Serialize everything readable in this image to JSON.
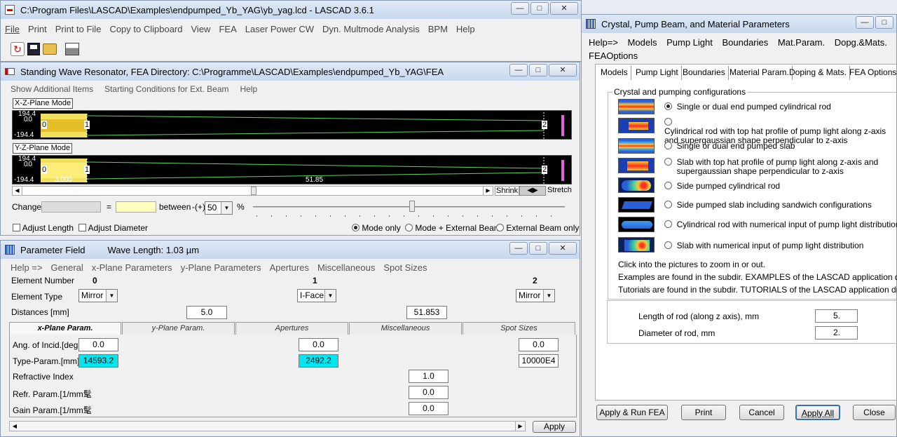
{
  "main_window": {
    "title": "C:\\Program Files\\LASCAD\\Examples\\endpumped_Yb_YAG\\yb_yag.lcd - LASCAD 3.6.1",
    "menu": [
      "File",
      "Print",
      "Print to File",
      "Copy to Clipboard",
      "View",
      "FEA",
      "Laser Power CW",
      "Dyn. Multmode Analysis",
      "BPM",
      "Help"
    ],
    "toolbar_icons": [
      "refresh-icon",
      "save-icon",
      "open-folder-icon",
      "printer-icon"
    ]
  },
  "resonator": {
    "title": "Standing Wave Resonator, FEA Directory: C:\\Programme\\LASCAD\\Examples\\endpumped_Yb_YAG\\FEA",
    "menu": [
      "Show Additional Items",
      "Starting Conditions for Ext. Beam",
      "Help"
    ],
    "xz_label": "X-Z-Plane Mode",
    "yz_label": "Y-Z-Plane Mode",
    "plot_top": "194.4",
    "plot_bottom": "-194.4",
    "plot_mid": "0.0",
    "element_labels": [
      "0",
      "1",
      "2"
    ],
    "yz_left_value": "3.000",
    "yz_mid_value": "51.85",
    "shrink_label": "Shrink",
    "stretch_label": "Stretch",
    "change_label": "Change",
    "equals": "=",
    "between_label": "between",
    "plusminus": "-(+)",
    "between_value": "50",
    "percent": "%",
    "adjust_length": "Adjust Length",
    "adjust_diameter": "Adjust Diameter",
    "mode_options": [
      "Mode only",
      "Mode + External Beam",
      "External Beam only"
    ],
    "mode_selected": "Mode only"
  },
  "param_field": {
    "title": "Parameter Field",
    "wavelength": "Wave Length: 1.03 µm",
    "menu": [
      "Help =>",
      "General",
      "x-Plane Parameters",
      "y-Plane Parameters",
      "Apertures",
      "Miscellaneous",
      "Spot Sizes"
    ],
    "element_number_label": "Element Number",
    "element_numbers": [
      "0",
      "1",
      "2"
    ],
    "element_type_label": "Element Type",
    "element_types": [
      "Mirror",
      "I-Face",
      "Mirror"
    ],
    "distances_label": "Distances [mm]",
    "distances": [
      "5.0",
      "51.853"
    ],
    "tabs": [
      "x-Plane Param.",
      "y-Plane Param.",
      "Apertures",
      "Miscellaneous",
      "Spot Sizes"
    ],
    "rows": {
      "angle_label": "Ang. of Incid.[deg.]",
      "angle_values": [
        "0.0",
        "0.0",
        "0.0"
      ],
      "type_label": "Type-Param.[mm]",
      "type_values": [
        "14593.2",
        "2492.2",
        "10000E4"
      ],
      "refr_index_label": "Refractive Index",
      "refr_index_value": "1.0",
      "refr_param_label": "Refr. Param.[1/mm髦",
      "refr_param_value": "0.0",
      "gain_param_label": "Gain Param.[1/mm髦",
      "gain_param_value": "0.0"
    },
    "apply_label": "Apply"
  },
  "crystal_dialog": {
    "title": "Crystal, Pump Beam, and Material Parameters",
    "menu": [
      "Help=>",
      "Models",
      "Pump Light",
      "Boundaries",
      "Mat.Param.",
      "Dopg.&Mats.",
      "FEAOptions"
    ],
    "tabs": [
      "Models",
      "Pump Light",
      "Boundaries",
      "Material Param.",
      "Doping & Mats.",
      "FEA Options"
    ],
    "group_title": "Crystal and pumping configurations",
    "configs": [
      "Single or dual end pumped cylindrical rod",
      "Cylindrical rod with top hat profile of pump light along z-axis\nand supergaussian shape perpendicular to z-axis",
      "Single or dual end pumped slab",
      "Slab with top hat profile of pump light along z-axis and\nsupergaussian shape perpendicular to z-axis",
      "Side pumped cylindrical rod",
      "Side pumped slab including sandwich configurations",
      "Cylindrical rod with numerical input of pump light distribution",
      "Slab with numerical input of pump light distribution"
    ],
    "selected_config": 0,
    "info": [
      "Click into the pictures to zoom in or out.",
      "Examples are found in the subdir. EXAMPLES of the LASCAD application dir.",
      "Tutorials are found in the subdir. TUTORIALS of the LASCAD application dir."
    ],
    "length_label": "Length of rod (along z axis), mm",
    "length_value": "5.",
    "diameter_label": "Diameter of rod, mm",
    "diameter_value": "2.",
    "buttons": [
      "Apply  & Run FEA",
      "Print",
      "Cancel",
      "Apply All",
      "Close"
    ]
  },
  "colors": {
    "title_bar": "#c7d8ee",
    "plot_bg": "#000000",
    "beam": "#5cd65c",
    "crystal": "#f0e060",
    "marker": "#e060e0",
    "cyan_field": "#00e5ee"
  }
}
